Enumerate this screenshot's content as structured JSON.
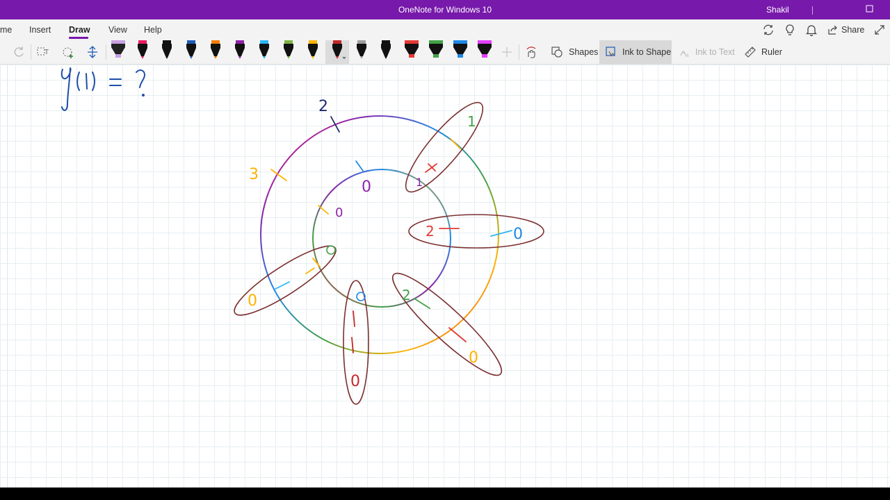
{
  "window": {
    "title": "OneNote for Windows 10",
    "user": "Shakil",
    "accent_color": "#7719aa"
  },
  "ribbon": {
    "tabs": [
      {
        "label": "me",
        "active": false
      },
      {
        "label": "Insert",
        "active": false
      },
      {
        "label": "Draw",
        "active": true
      },
      {
        "label": "View",
        "active": false
      },
      {
        "label": "Help",
        "active": false
      }
    ],
    "right_icons": [
      "sync-icon",
      "lightbulb-icon",
      "bell-icon"
    ],
    "share_label": "Share"
  },
  "toolbar": {
    "tools": [
      "redo-icon",
      "lasso-select-icon",
      "eraser-add-icon",
      "add-space-icon"
    ],
    "pens": [
      {
        "kind": "highlighter",
        "color": "#c9a0e0"
      },
      {
        "kind": "pen",
        "color": "#e91e63"
      },
      {
        "kind": "pen",
        "color": "#111111"
      },
      {
        "kind": "pen",
        "color": "#1e5bb8"
      },
      {
        "kind": "pen",
        "color": "#f57c00"
      },
      {
        "kind": "pen",
        "color": "#8e24aa"
      },
      {
        "kind": "pen",
        "color": "#29b6f6"
      },
      {
        "kind": "pen",
        "color": "#7cb342"
      },
      {
        "kind": "pen",
        "color": "#ffb300"
      },
      {
        "kind": "pen",
        "color": "#c62828",
        "selected": true
      },
      {
        "kind": "pen",
        "color": "#9e9e9e"
      },
      {
        "kind": "pen",
        "color": "#111111"
      },
      {
        "kind": "highlighter",
        "color": "#e53935"
      },
      {
        "kind": "highlighter",
        "color": "#43a047"
      },
      {
        "kind": "highlighter",
        "color": "#1e88e5"
      },
      {
        "kind": "highlighter",
        "color": "#e040fb"
      }
    ],
    "add_pen_icon": "plus-icon",
    "touch_draw_icon": "touch-draw-icon",
    "shapes_label": "Shapes",
    "ink_to_shape_label": "Ink to Shape",
    "ink_to_text_label": "Ink to Text",
    "ruler_label": "Ruler"
  },
  "canvas": {
    "annotations": {
      "top_left_equation": "g(1) = ?",
      "outer_labels": [
        "2",
        "3",
        "1",
        "0",
        "2",
        "0",
        "0",
        "0"
      ],
      "inner_labels": [
        "0",
        "0"
      ]
    }
  }
}
